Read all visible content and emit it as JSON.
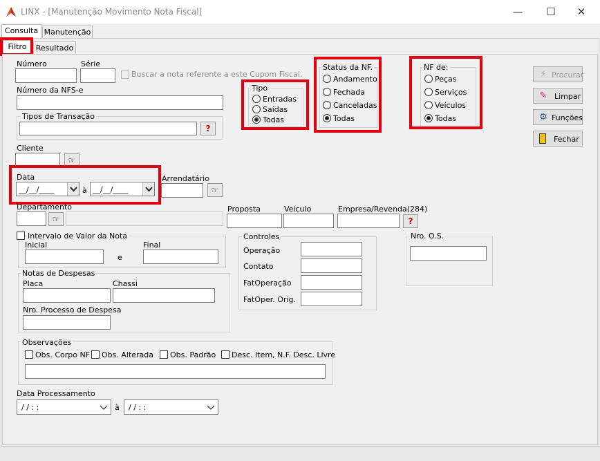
{
  "window": {
    "title": "LINX - [Manutenção Movimento Nota Fiscal]",
    "controls": {
      "minimize": "—",
      "maximize": "☐",
      "close": "✕"
    }
  },
  "top_tabs": [
    {
      "label": "Consulta"
    },
    {
      "label": "Manutenção"
    }
  ],
  "sub_tabs": [
    {
      "label": "Filtro"
    },
    {
      "label": "Resultado"
    }
  ],
  "form": {
    "numero_label": "Número",
    "serie_label": "Série",
    "cupom_check_label": "Buscar a nota referente a este Cupom Fiscal.",
    "nfse_label": "Número da NFS-e",
    "tipos_transacao_label": "Tipos de Transação",
    "cliente_label": "Cliente",
    "data_label": "Data",
    "date_placeholder": "__/__/____",
    "date_sep": "à",
    "arrendatario_label": "Arrendatário",
    "departamento_label": "Departamento",
    "proposta_label": "Proposta",
    "veiculo_label": "Veículo",
    "empresa_label": "Empresa/Revenda(284)",
    "intervalo_label": "Intervalo de Valor da Nota",
    "inicial_label": "Inicial",
    "e_label": "e",
    "final_label": "Final",
    "notas_despesas_label": "Notas de Despesas",
    "placa_label": "Placa",
    "chassi_label": "Chassi",
    "nro_processo_label": "Nro. Processo de Despesa",
    "controles": {
      "title": "Controles",
      "fields": [
        "Operação",
        "Contato",
        "FatOperação",
        "FatOper. Orig."
      ]
    },
    "nro_os_label": "Nro. O.S.",
    "observacoes": {
      "title": "Observações",
      "checks": [
        "Obs. Corpo NF",
        "Obs. Alterada",
        "Obs. Padrão",
        "Desc. Item, N.F. Desc. Livre"
      ]
    },
    "data_processamento_label": "Data Processamento",
    "dp_value": "/ /     : :",
    "dp_sep": "à"
  },
  "tipo": {
    "title": "Tipo",
    "options": [
      "Entradas",
      "Saídas",
      "Todas"
    ],
    "selected": "Todas"
  },
  "status_nf": {
    "title": "Status da NF.",
    "options": [
      "Andamento",
      "Fechada",
      "Canceladas",
      "Todas"
    ],
    "selected": "Todas"
  },
  "nf_de": {
    "title": "NF de:",
    "options": [
      "Peças",
      "Serviços",
      "Veículos",
      "Todas"
    ],
    "selected": "Todas"
  },
  "buttons": {
    "procurar": "Procurar",
    "limpar": "Limpar",
    "funcoes": "Funções",
    "fechar": "Fechar"
  },
  "icons": {
    "lookup": "pointing-hand-icon",
    "help": "question-icon"
  },
  "colors": {
    "highlight": "#e0000f",
    "title_text": "#8a8a8a"
  }
}
